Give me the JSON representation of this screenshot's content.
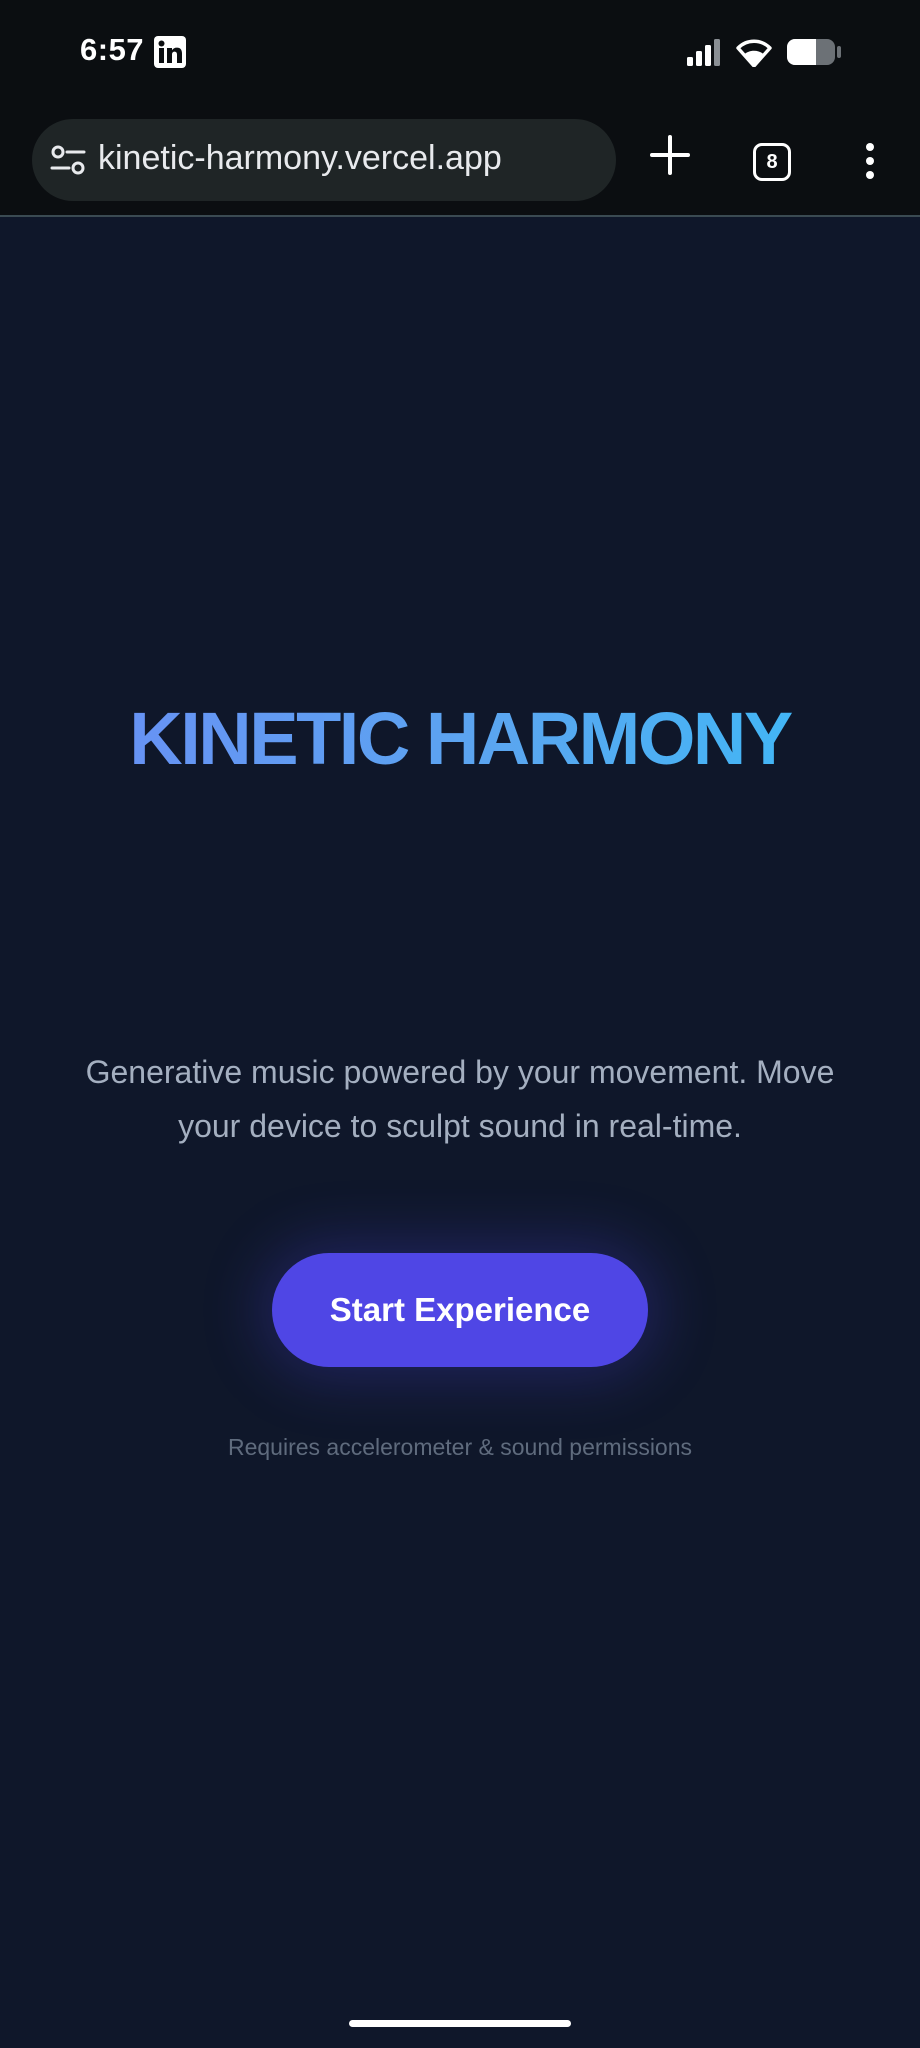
{
  "status_bar": {
    "time": "6:57",
    "notification_icon": "linkedin-icon",
    "icons": [
      "signal-icon",
      "wifi-icon",
      "battery-icon"
    ]
  },
  "browser": {
    "url": "kinetic-harmony.vercel.app",
    "tab_count": "8",
    "icons": [
      "site-settings-icon",
      "new-tab-icon",
      "tabs-icon",
      "more-menu-icon"
    ]
  },
  "hero": {
    "title": "KINETIC HARMONY",
    "subtitle": "Generative music powered by your movement. Move your device to sculpt sound in real-time.",
    "cta_label": "Start Experience",
    "note": "Requires accelerometer & sound permissions"
  },
  "colors": {
    "background": "#0f172a",
    "title_gradient_start": "#6b8cf5",
    "title_gradient_end": "#38bdf8",
    "button": "#4f46e5",
    "subtitle": "#a4afc0",
    "note": "#5f6b7d"
  }
}
